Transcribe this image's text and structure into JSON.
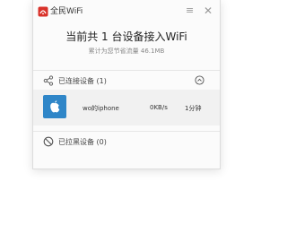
{
  "app": {
    "title": "全民WiFi",
    "brand_color": "#d9322a",
    "menu_icon": "menu-icon",
    "close_icon": "close-icon"
  },
  "summary": {
    "headline": "当前共 1 台设备接入WiFi",
    "saved_traffic": "累计为您节省流量 46.1MB"
  },
  "connected": {
    "label": "已连接设备 (1)",
    "icon": "share-icon",
    "toggle_icon": "chevron-up-circle-icon",
    "devices": [
      {
        "name": "wo的iphone",
        "speed": "0KB/s",
        "duration": "1分钟",
        "icon": "apple-icon",
        "icon_bg": "#2f86c8"
      }
    ]
  },
  "blocked": {
    "label": "已拉黑设备 (0)",
    "icon": "block-icon"
  }
}
